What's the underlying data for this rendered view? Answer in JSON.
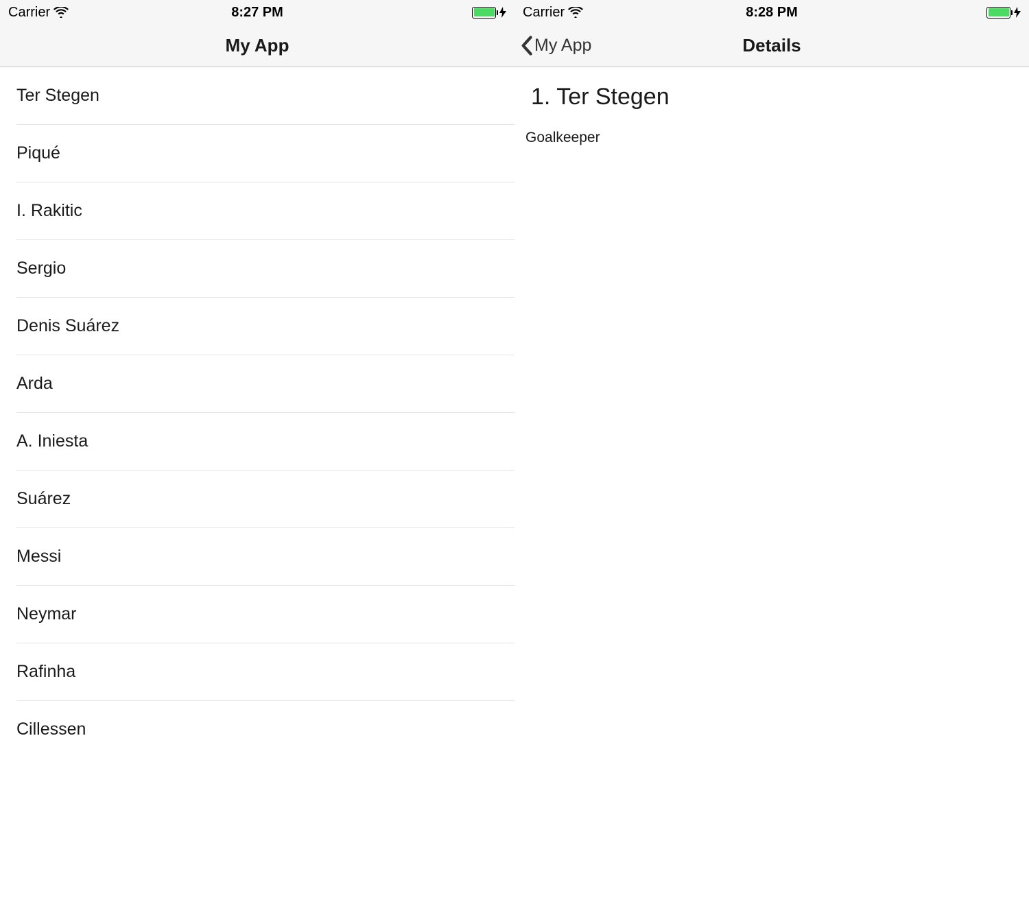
{
  "left": {
    "statusbar": {
      "carrier": "Carrier",
      "time": "8:27 PM"
    },
    "nav": {
      "title": "My App"
    },
    "list": {
      "items": [
        "Ter Stegen",
        "Piqué",
        "I. Rakitic",
        "Sergio",
        "Denis Suárez",
        "Arda",
        "A. Iniesta",
        "Suárez",
        "Messi",
        "Neymar",
        "Rafinha",
        "Cillessen"
      ]
    }
  },
  "right": {
    "statusbar": {
      "carrier": "Carrier",
      "time": "8:28 PM"
    },
    "nav": {
      "back_label": "My App",
      "title": "Details"
    },
    "detail": {
      "title": "1. Ter Stegen",
      "subtitle": "Goalkeeper"
    }
  }
}
